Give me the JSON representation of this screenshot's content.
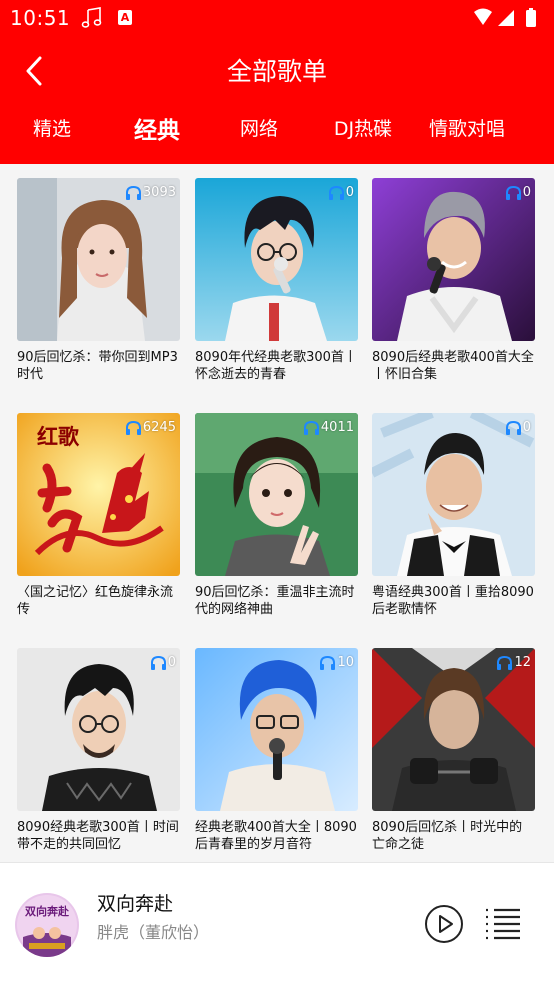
{
  "status_bar": {
    "time": "10:51",
    "notification_letter": "A"
  },
  "header": {
    "title": "全部歌单"
  },
  "tabs": [
    {
      "label": "精选"
    },
    {
      "label": "经典",
      "active": true
    },
    {
      "label": "网络"
    },
    {
      "label": "DJ热碟"
    },
    {
      "label": "情歌对唱"
    }
  ],
  "playlists": [
    {
      "title": "90后回忆杀：带你回到MP3时代",
      "plays": "3093",
      "thumb": "portrait-woman-long-hair"
    },
    {
      "title": "8090年代经典老歌300首丨怀念逝去的青春",
      "plays": "0",
      "thumb": "singer-with-glasses-microphone"
    },
    {
      "title": "8090后经典老歌400首大全丨怀旧合集",
      "plays": "0",
      "thumb": "singer-silver-hair-purple-stage"
    },
    {
      "title": "〈国之记忆〉红色旋律永流传",
      "plays": "6245",
      "thumb": "red-song-poster",
      "thumb_text": "红歌"
    },
    {
      "title": "90后回忆杀：重温非主流时代的网络神曲",
      "plays": "4011",
      "thumb": "girl-peace-sign"
    },
    {
      "title": "粤语经典300首丨重拾8090后老歌情怀",
      "plays": "0",
      "thumb": "smiling-man-tuxedo"
    },
    {
      "title": "8090经典老歌300首丨时间带不走的共同回忆",
      "plays": "0",
      "thumb": "man-glasses-beard"
    },
    {
      "title": "经典老歌400首大全丨8090后青春里的岁月音符",
      "plays": "10",
      "thumb": "blue-hair-singer"
    },
    {
      "title": "8090后回忆杀丨时光中的亡命之徒",
      "plays": "12",
      "thumb": "movie-heroine-poster"
    }
  ],
  "player": {
    "song": "双向奔赴",
    "artist": "胖虎（董欣怡）",
    "album_text": "双向奔赴"
  },
  "colors": {
    "brand": "#ff0000",
    "background": "#f5f5f5",
    "text": "#111111",
    "secondary_text": "#888888"
  }
}
